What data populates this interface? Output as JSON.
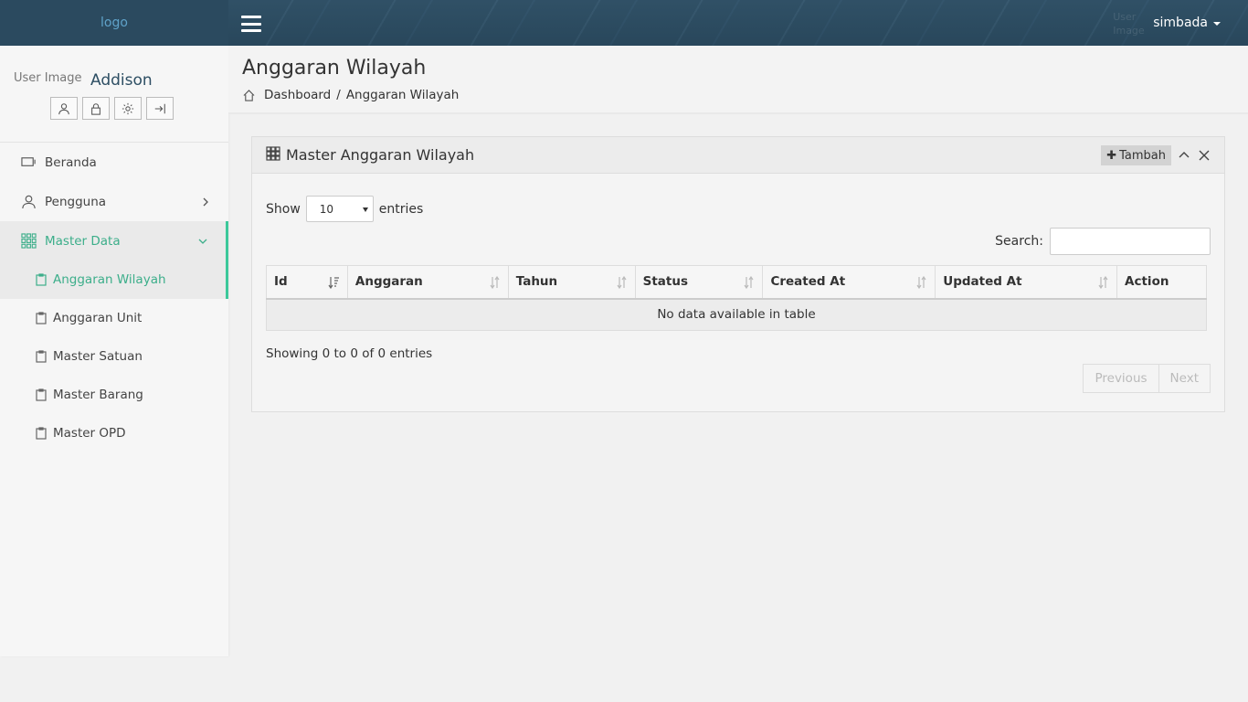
{
  "header": {
    "logo_text": "logo",
    "user_ghost_line1": "User",
    "user_ghost_line2": "Image",
    "username": "simbada"
  },
  "sidebar": {
    "user_image_alt": "User Image",
    "user_name": "Addison",
    "profile_buttons": [
      "user-icon",
      "lock-icon",
      "gear-icon",
      "logout-icon"
    ],
    "items": [
      {
        "label": "Beranda",
        "icon": "monitor-icon"
      },
      {
        "label": "Pengguna",
        "icon": "user-icon"
      },
      {
        "label": "Master Data",
        "icon": "grid-icon"
      }
    ],
    "subitems": [
      {
        "label": "Anggaran Wilayah"
      },
      {
        "label": "Anggaran Unit"
      },
      {
        "label": "Master Satuan"
      },
      {
        "label": "Master Barang"
      },
      {
        "label": "Master OPD"
      }
    ]
  },
  "page": {
    "title": "Anggaran Wilayah",
    "breadcrumb": {
      "home": "Dashboard",
      "separator": "/",
      "current": "Anggaran Wilayah"
    }
  },
  "panel": {
    "title": "Master Anggaran Wilayah",
    "add_label": "Tambah",
    "show_label": "Show",
    "entries_label": "entries",
    "page_length": "10",
    "search_label": "Search:",
    "search_value": "",
    "columns": [
      "Id",
      "Anggaran",
      "Tahun",
      "Status",
      "Created At",
      "Updated At",
      "Action"
    ],
    "empty_text": "No data available in table",
    "info": "Showing 0 to 0 of 0 entries",
    "prev_label": "Previous",
    "next_label": "Next"
  },
  "colors": {
    "navbar": "#2c4d63",
    "accent": "#3cae8a",
    "link": "#5fa2c9"
  }
}
